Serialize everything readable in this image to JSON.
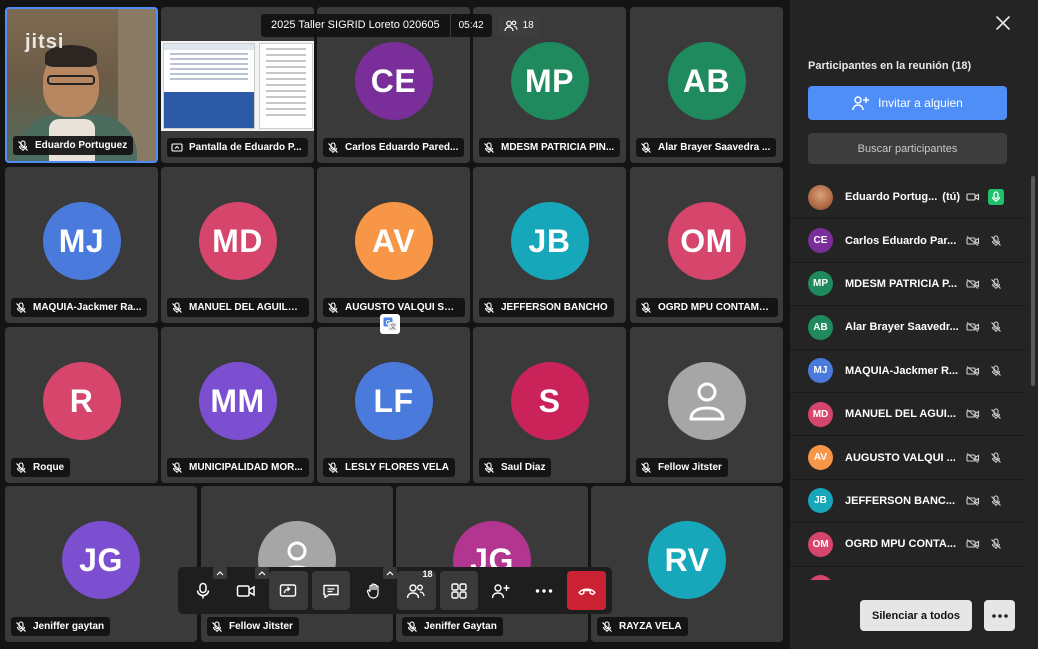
{
  "header": {
    "meeting_title": "2025 Taller SIGRID Loreto 020605",
    "timer": "05:42",
    "participant_count": "18"
  },
  "watermark": "jitsi",
  "tiles": [
    {
      "name": "Eduardo Portuguez",
      "kind": "self-video"
    },
    {
      "name": "Pantalla de Eduardo P...",
      "kind": "screenshare"
    },
    {
      "name": "Carlos Eduardo Pared...",
      "initials": "CE",
      "color": "#7a2e9a"
    },
    {
      "name": "MDESM PATRICIA PIN...",
      "initials": "MP",
      "color": "#1e8a5e"
    },
    {
      "name": "Alar Brayer Saavedra ...",
      "initials": "AB",
      "color": "#1e8a5e"
    },
    {
      "name": "MAQUIA-Jackmer Ra...",
      "initials": "MJ",
      "color": "#4a7bdc"
    },
    {
      "name": "MANUEL DEL AGUILA...",
      "initials": "MD",
      "color": "#d6456b"
    },
    {
      "name": "AUGUSTO VALQUI SC...",
      "initials": "AV",
      "color": "#f79646"
    },
    {
      "name": "JEFFERSON BANCHO",
      "initials": "JB",
      "color": "#16a7ba"
    },
    {
      "name": "OGRD MPU CONTAMA...",
      "initials": "OM",
      "color": "#d6456b"
    },
    {
      "name": "Roque",
      "initials": "R",
      "color": "#d6456b"
    },
    {
      "name": "MUNICIPALIDAD MOR...",
      "initials": "MM",
      "color": "#7b4fcf"
    },
    {
      "name": "LESLY FLORES VELA",
      "initials": "LF",
      "color": "#4a7bdc"
    },
    {
      "name": "Saul Diaz",
      "initials": "S",
      "color": "#c9235a"
    },
    {
      "name": "Fellow Jitster",
      "initials": "",
      "color": "#a6a6a6",
      "default_avatar": true
    },
    {
      "name": "Jeniffer gaytan",
      "initials": "JG",
      "color": "#7b4fcf"
    },
    {
      "name": "Fellow Jitster",
      "initials": "",
      "color": "#a6a6a6",
      "default_avatar": true
    },
    {
      "name": "Jeniffer Gaytan",
      "initials": "JG",
      "color": "#b2358f"
    },
    {
      "name": "RAYZA VELA",
      "initials": "RV",
      "color": "#16a7ba"
    }
  ],
  "toolbar": {
    "participants_badge": "18",
    "buttons": [
      "microphone",
      "camera",
      "share-screen",
      "chat",
      "raise-hand",
      "participants",
      "tile-view",
      "invite",
      "more",
      "hangup"
    ]
  },
  "panel": {
    "title": "Participantes en la reunión (18)",
    "invite_label": "Invitar a alguien",
    "search_placeholder": "Buscar participantes",
    "mute_all_label": "Silenciar a todos",
    "participants": [
      {
        "name": "Eduardo Portug...",
        "you_label": "(tú)",
        "initials": "",
        "color": "#c08060",
        "is_self": true
      },
      {
        "name": "Carlos Eduardo Par...",
        "initials": "CE",
        "color": "#7a2e9a"
      },
      {
        "name": "MDESM PATRICIA P...",
        "initials": "MP",
        "color": "#1e8a5e"
      },
      {
        "name": "Alar Brayer Saavedr...",
        "initials": "AB",
        "color": "#1e8a5e"
      },
      {
        "name": "MAQUIA-Jackmer R...",
        "initials": "MJ",
        "color": "#4a7bdc"
      },
      {
        "name": "MANUEL DEL AGUI...",
        "initials": "MD",
        "color": "#d6456b"
      },
      {
        "name": "AUGUSTO VALQUI ...",
        "initials": "AV",
        "color": "#f79646"
      },
      {
        "name": "JEFFERSON BANC...",
        "initials": "JB",
        "color": "#16a7ba"
      },
      {
        "name": "OGRD MPU CONTA...",
        "initials": "OM",
        "color": "#d6456b"
      },
      {
        "name": "",
        "initials": "",
        "color": "#d6456b"
      }
    ]
  }
}
